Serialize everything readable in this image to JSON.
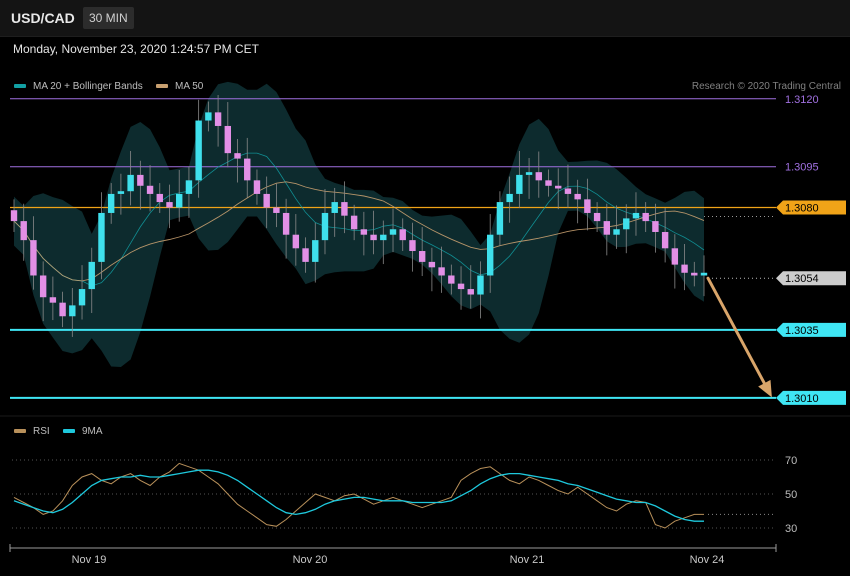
{
  "header": {
    "symbol": "USD/CAD",
    "timeframe": "30 MIN"
  },
  "timestamp": "Monday, November 23, 2020 1:24:57 PM CET",
  "legend": {
    "main": [
      {
        "label": "MA 20 + Bollinger Bands",
        "color": "#12a0a4"
      },
      {
        "label": "MA 50",
        "color": "#c8a070"
      }
    ],
    "indicator": [
      {
        "label": "RSI",
        "color": "#b8905a"
      },
      {
        "label": "9MA",
        "color": "#1ec8dc"
      }
    ]
  },
  "credit": "Research © 2020 Trading Central",
  "colors": {
    "bull": "#3fe0ec",
    "bear": "#e28fe6",
    "support": "#3fe6f4",
    "resistance": "#a070e0",
    "pivot": "#f0a318",
    "last": "#cccccc",
    "arrow": "#d9a56a",
    "band_fill": "#0d2b2e"
  },
  "chart_data": [
    {
      "type": "candlestick",
      "x_ticks": [
        "Nov 19",
        "Nov 20",
        "Nov 21",
        "Nov 24"
      ],
      "ylim": [
        1.3,
        1.3135
      ],
      "levels": [
        {
          "value": 1.312,
          "label": "1.3120",
          "kind": "resistance"
        },
        {
          "value": 1.3095,
          "label": "1.3095",
          "kind": "resistance"
        },
        {
          "value": 1.308,
          "label": "1.3080",
          "kind": "pivot"
        },
        {
          "value": 1.3054,
          "label": "1.3054",
          "kind": "last"
        },
        {
          "value": 1.3035,
          "label": "1.3035",
          "kind": "support"
        },
        {
          "value": 1.301,
          "label": "1.3010",
          "kind": "support"
        }
      ],
      "series_close": [
        1.3075,
        1.3068,
        1.3055,
        1.3047,
        1.3045,
        1.304,
        1.3044,
        1.305,
        1.306,
        1.3078,
        1.3085,
        1.3086,
        1.3092,
        1.3088,
        1.3085,
        1.3082,
        1.308,
        1.3085,
        1.309,
        1.3112,
        1.3115,
        1.311,
        1.31,
        1.3098,
        1.309,
        1.3085,
        1.308,
        1.3078,
        1.307,
        1.3065,
        1.306,
        1.3068,
        1.3078,
        1.3082,
        1.3077,
        1.3072,
        1.307,
        1.3068,
        1.307,
        1.3072,
        1.3068,
        1.3064,
        1.306,
        1.3058,
        1.3055,
        1.3052,
        1.305,
        1.3048,
        1.3055,
        1.307,
        1.3082,
        1.3085,
        1.3092,
        1.3093,
        1.309,
        1.3088,
        1.3087,
        1.3085,
        1.3083,
        1.3078,
        1.3075,
        1.307,
        1.3072,
        1.3076,
        1.3078,
        1.3075,
        1.3071,
        1.3065,
        1.3059,
        1.3056,
        1.3055,
        1.3056
      ],
      "annotation": {
        "type": "arrow",
        "from": 1.3054,
        "to": 1.301
      }
    },
    {
      "type": "line",
      "name": "RSI",
      "yticks": [
        70,
        50,
        30
      ],
      "ylim": [
        20,
        80
      ],
      "series": [
        {
          "name": "RSI",
          "values": [
            48,
            45,
            42,
            38,
            40,
            46,
            55,
            60,
            62,
            58,
            56,
            60,
            62,
            58,
            55,
            60,
            63,
            68,
            66,
            64,
            60,
            56,
            50,
            44,
            40,
            36,
            32,
            31,
            35,
            40,
            45,
            50,
            48,
            46,
            49,
            50,
            47,
            44,
            46,
            48,
            46,
            44,
            42,
            44,
            46,
            48,
            58,
            62,
            65,
            66,
            62,
            58,
            56,
            60,
            58,
            55,
            52,
            50,
            54,
            50,
            46,
            42,
            40,
            44,
            46,
            45,
            32,
            30,
            34,
            36,
            38,
            38
          ]
        },
        {
          "name": "9MA",
          "values": [
            46,
            44,
            42,
            40,
            39,
            41,
            45,
            50,
            55,
            58,
            59,
            60,
            60,
            61,
            60,
            60,
            61,
            62,
            63,
            64,
            64,
            63,
            61,
            58,
            54,
            50,
            46,
            42,
            39,
            38,
            39,
            41,
            44,
            46,
            47,
            48,
            48,
            47,
            46,
            46,
            46,
            45,
            45,
            45,
            45,
            46,
            49,
            52,
            56,
            59,
            61,
            62,
            62,
            61,
            60,
            59,
            58,
            56,
            55,
            53,
            51,
            49,
            47,
            46,
            45,
            45,
            43,
            40,
            37,
            35,
            34,
            34
          ]
        }
      ]
    }
  ]
}
